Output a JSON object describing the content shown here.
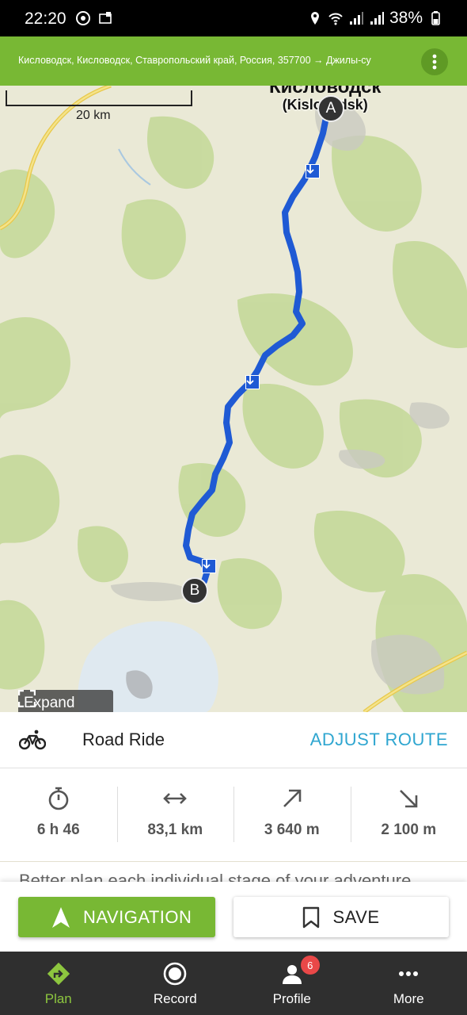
{
  "status_bar": {
    "time": "22:20",
    "battery": "38%",
    "icons": [
      "chrome-icon",
      "notification-icon",
      "location-icon",
      "wifi-icon",
      "signal-icon",
      "signal-icon",
      "battery-icon"
    ]
  },
  "header": {
    "route": "Кисловодск, Кисловодск, Ставропольский край, Россия, 357700 → Джилы-су",
    "menu_icon": "more-vertical-icon",
    "color": "#78b834"
  },
  "map": {
    "scale_label": "20 km",
    "city_name": "Кисловодск",
    "city_name_latin": "(Kislovodsk)",
    "start_marker": "A",
    "end_marker": "B",
    "expand_label": "Expand",
    "route_color": "#1f5ad4"
  },
  "panel": {
    "ride_type": "Road Ride",
    "ride_icon": "bicycle-icon",
    "adjust_route": "ADJUST ROUTE",
    "stats": [
      {
        "icon": "stopwatch-icon",
        "value": "6 h 46"
      },
      {
        "icon": "distance-arrows-icon",
        "value": "83,1 km"
      },
      {
        "icon": "ascent-arrow-icon",
        "value": "3 640 m"
      },
      {
        "icon": "descent-arrow-icon",
        "value": "2 100 m"
      }
    ],
    "promo_text": "Better plan each individual stage of your adventure"
  },
  "actions": {
    "navigation": "NAVIGATION",
    "save": "SAVE"
  },
  "bottom_nav": [
    {
      "label": "Plan",
      "icon": "plan-icon",
      "active": true
    },
    {
      "label": "Record",
      "icon": "record-icon"
    },
    {
      "label": "Profile",
      "icon": "profile-icon",
      "badge": "6"
    },
    {
      "label": "More",
      "icon": "more-horizontal-icon"
    }
  ]
}
